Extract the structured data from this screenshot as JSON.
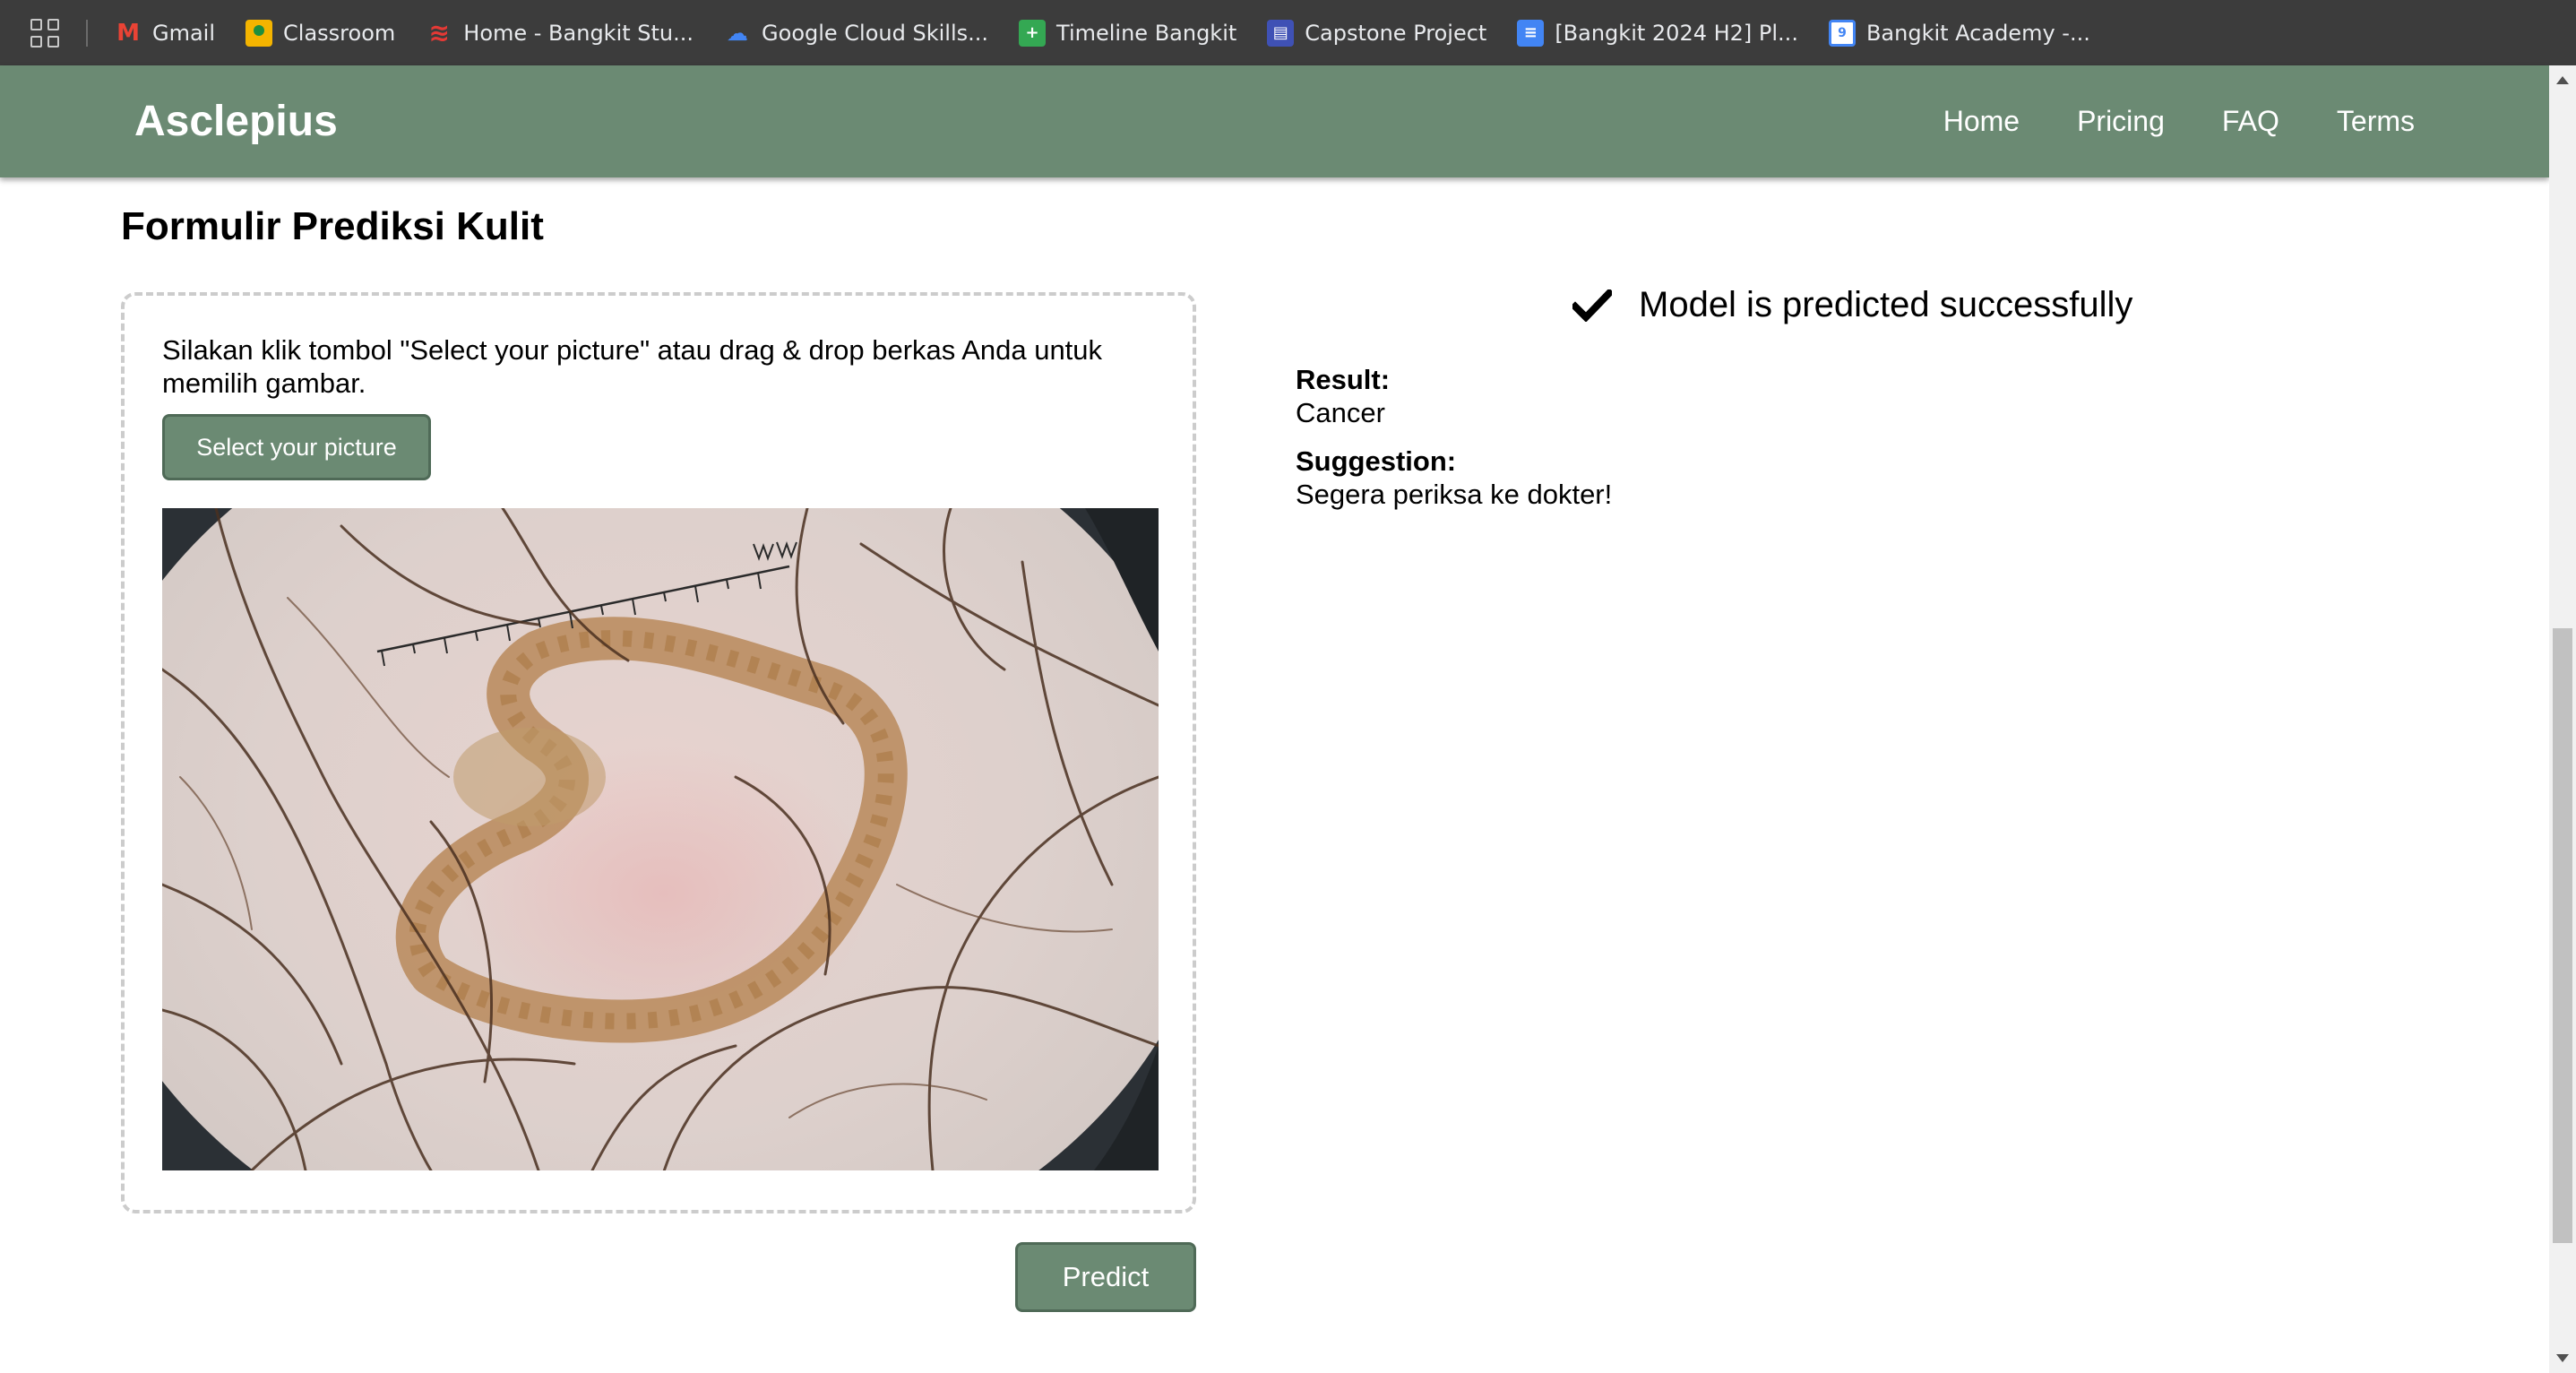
{
  "bookmarks": {
    "items": [
      {
        "label": "Gmail",
        "icon": "gmail-icon"
      },
      {
        "label": "Classroom",
        "icon": "classroom-icon"
      },
      {
        "label": "Home - Bangkit Stu...",
        "icon": "dicoding-icon"
      },
      {
        "label": "Google Cloud Skills...",
        "icon": "google-cloud-icon"
      },
      {
        "label": "Timeline Bangkit",
        "icon": "sheets-icon"
      },
      {
        "label": "Capstone Project",
        "icon": "sites-icon"
      },
      {
        "label": "[Bangkit 2024 H2] Pl...",
        "icon": "docs-icon"
      },
      {
        "label": "Bangkit Academy -...",
        "icon": "calendar-icon"
      }
    ]
  },
  "header": {
    "brand": "Asclepius",
    "nav": [
      "Home",
      "Pricing",
      "FAQ",
      "Terms"
    ],
    "background_color": "#6b8a73"
  },
  "main": {
    "title": "Formulir Prediksi Kulit",
    "upload": {
      "instruction": "Silakan klik tombol \"Select your picture\" atau drag & drop berkas Anda untuk memilih gambar.",
      "select_button": "Select your picture",
      "image_description": "dermoscopy-skin-lesion-image"
    },
    "predict_button": "Predict"
  },
  "result": {
    "status_icon": "checkmark-icon",
    "status_text": "Model is predicted successfully",
    "result_label": "Result:",
    "result_value": "Cancer",
    "suggestion_label": "Suggestion:",
    "suggestion_value": "Segera periksa ke dokter!"
  }
}
